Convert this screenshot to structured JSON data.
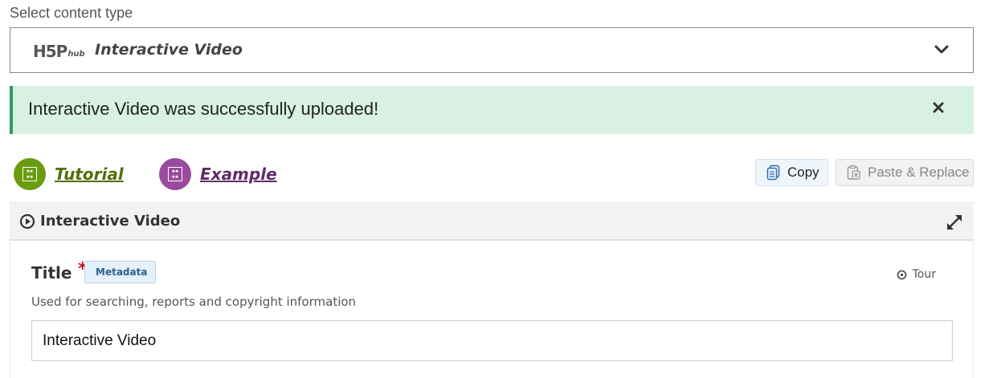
{
  "select_label": "Select content type",
  "selector": {
    "logo_text": "H5P",
    "logo_sub": "hub",
    "selected": "Interactive Video",
    "chevron_icon": "chevron-down-icon"
  },
  "alert": {
    "message": "Interactive Video was successfully uploaded!",
    "close_icon": "close-icon",
    "bg_color": "#d8f1e3",
    "accent_color": "#2f9a5b"
  },
  "help_links": {
    "tutorial": {
      "label": "Tutorial",
      "color": "#6a9c10"
    },
    "example": {
      "label": "Example",
      "color": "#9a4b9e"
    }
  },
  "buttons": {
    "copy": "Copy",
    "paste": "Paste & Replace"
  },
  "panel": {
    "title": "Interactive Video",
    "play_icon": "play-circle-icon",
    "expand_icon": "expand-icon"
  },
  "field": {
    "label": "Title",
    "required_mark": "*",
    "metadata": "Metadata",
    "tour": "Tour",
    "description": "Used for searching, reports and copyright information",
    "value": "Interactive Video"
  }
}
